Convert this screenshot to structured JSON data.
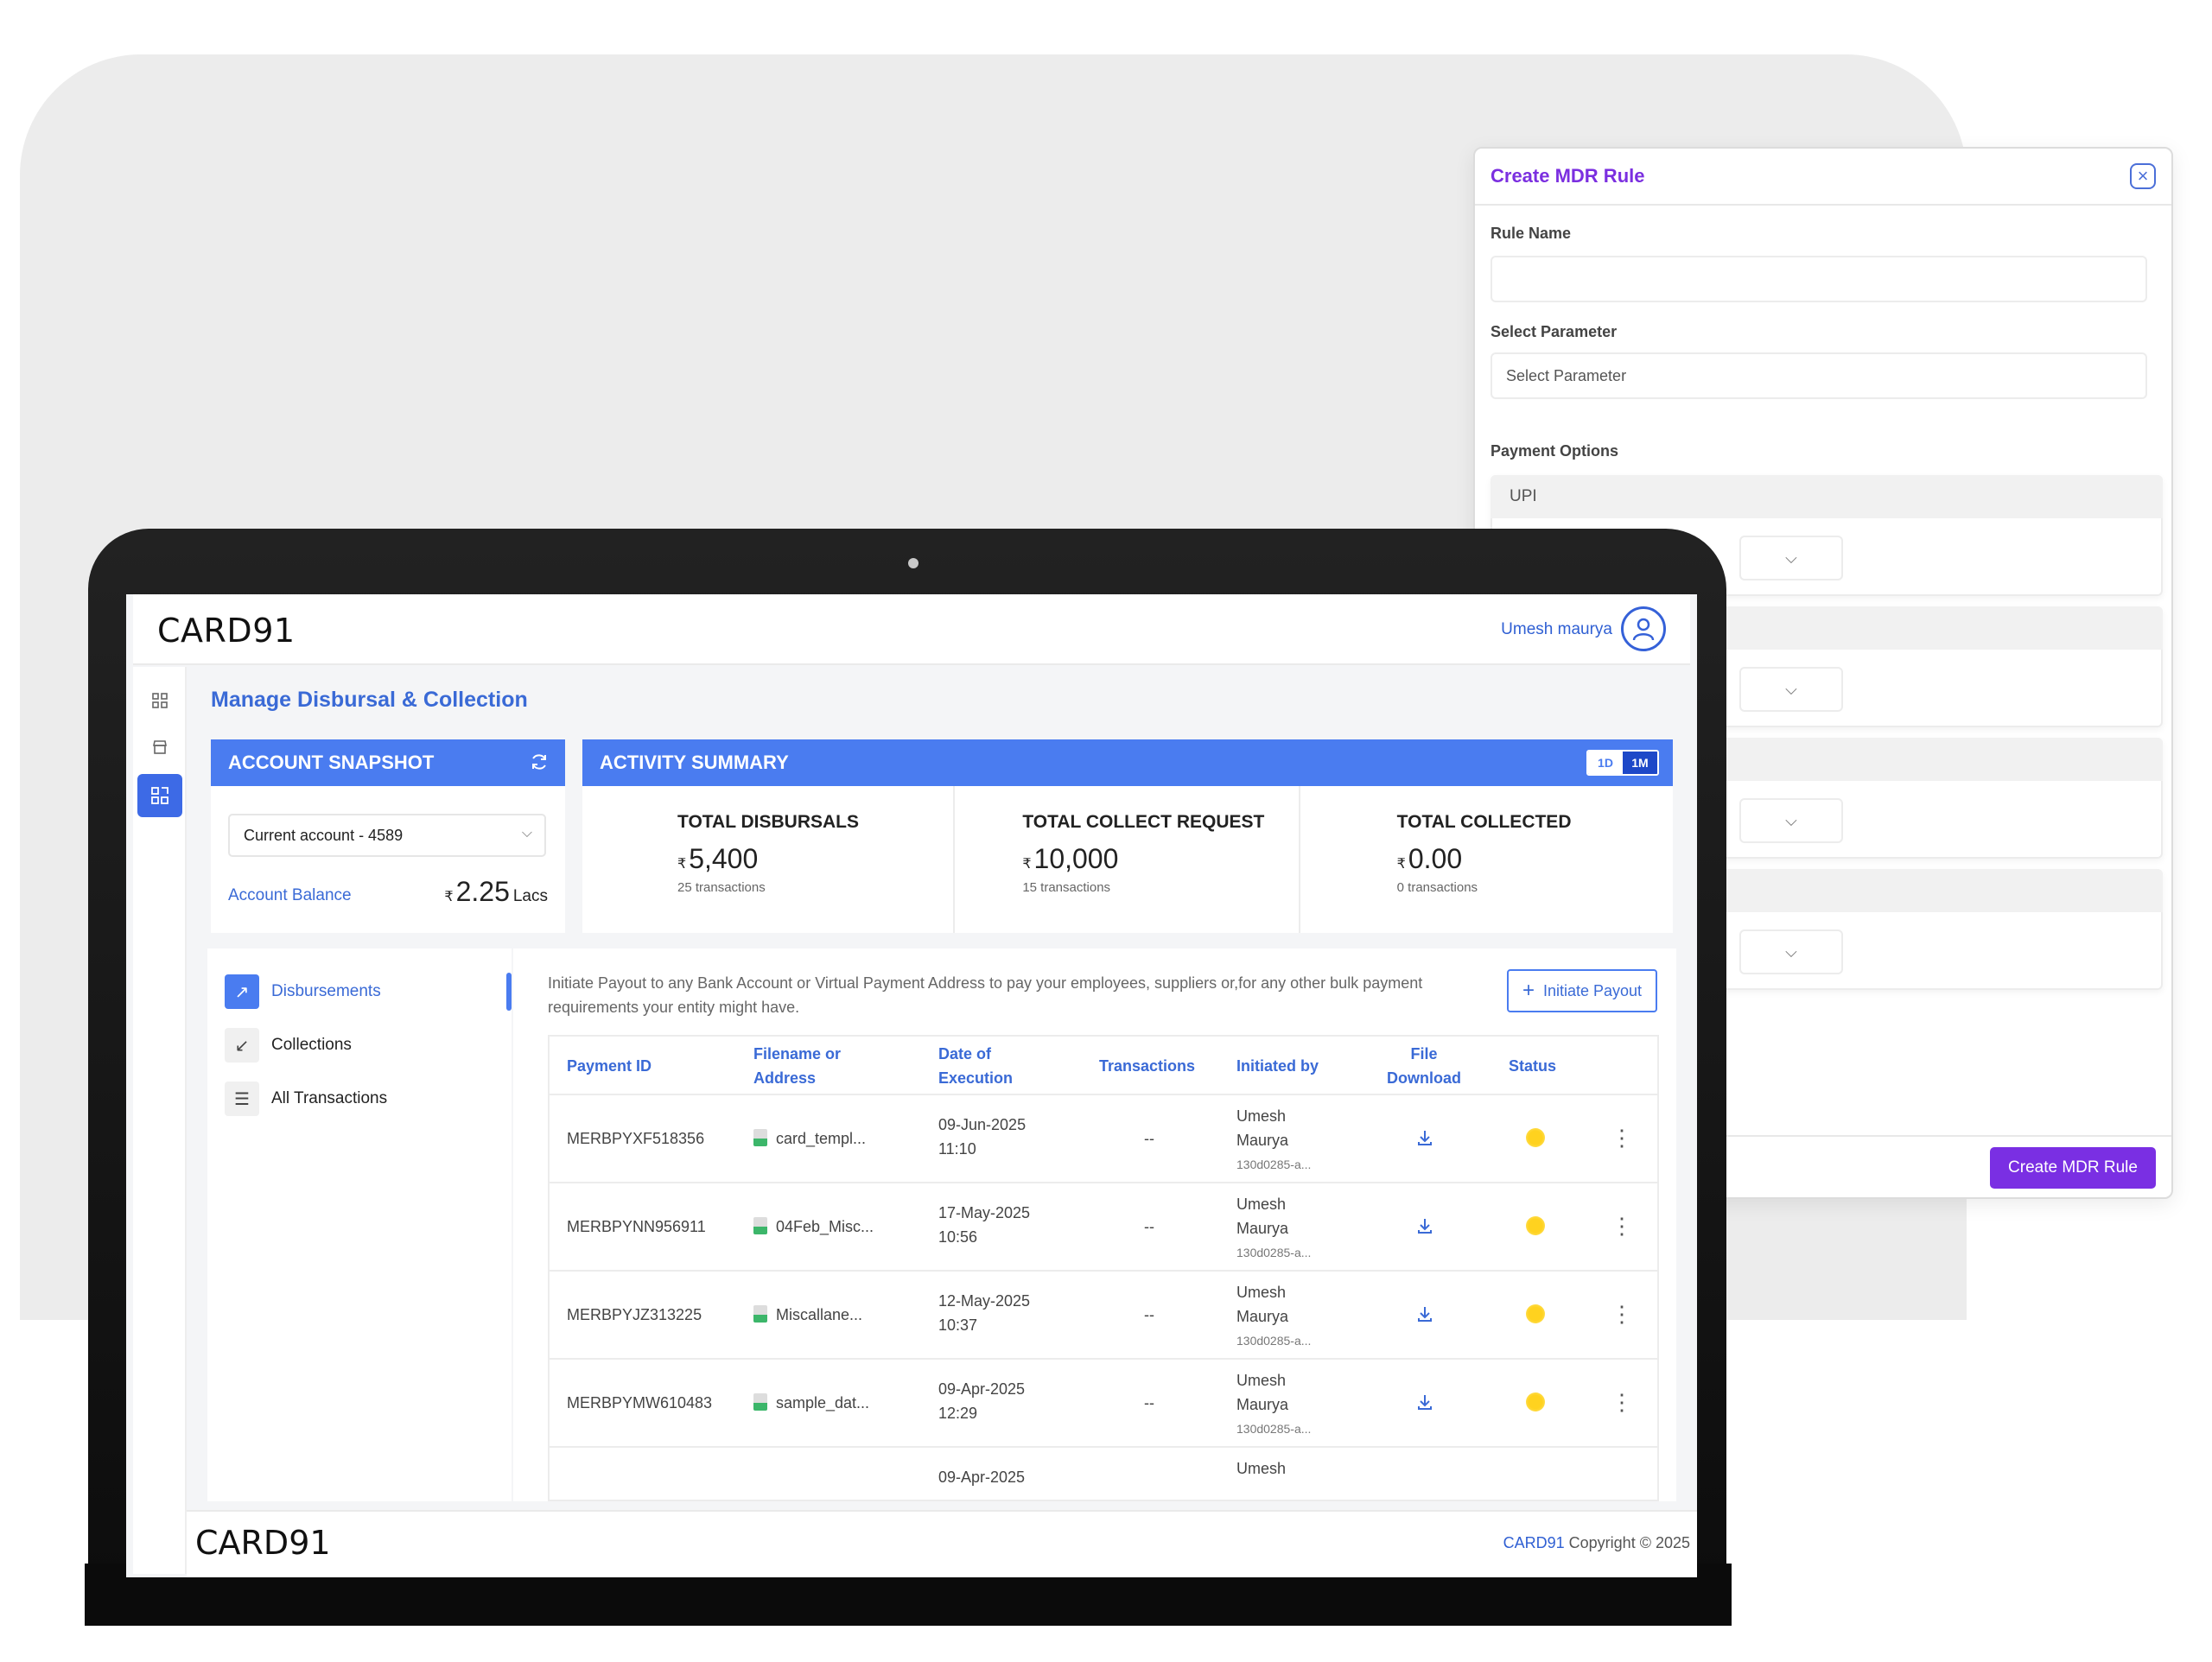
{
  "modal": {
    "title": "Create MDR Rule",
    "rule_name_label": "Rule Name",
    "rule_name_value": "",
    "select_param_label": "Select Parameter",
    "select_param_placeholder": "Select Parameter",
    "payment_options_label": "Payment Options",
    "payment_options": [
      "UPI",
      "",
      "",
      ""
    ],
    "submit_label": "Create MDR Rule"
  },
  "app": {
    "logo": "CARD91",
    "user_name": "Umesh maurya",
    "page_title": "Manage Disbursal & Collection"
  },
  "snapshot": {
    "title": "ACCOUNT SNAPSHOT",
    "account_select": "Current account - 4589",
    "balance_label": "Account Balance",
    "currency": "₹",
    "balance_value": "2.25",
    "balance_unit": "Lacs"
  },
  "activity": {
    "title": "ACTIVITY SUMMARY",
    "range_options": [
      "1D",
      "1M"
    ],
    "range_selected": "1M",
    "cards": [
      {
        "title": "TOTAL DISBURSALS",
        "currency": "₹",
        "value": "5,400",
        "sub": "25 transactions"
      },
      {
        "title": "TOTAL COLLECT REQUEST",
        "currency": "₹",
        "value": "10,000",
        "sub": "15 transactions"
      },
      {
        "title": "TOTAL COLLECTED",
        "currency": "₹",
        "value": "0.00",
        "sub": "0 transactions"
      }
    ]
  },
  "nav": {
    "items": [
      {
        "label": "Disbursements",
        "icon": "arrow-up-right-icon",
        "active": true
      },
      {
        "label": "Collections",
        "icon": "arrow-down-left-icon",
        "active": false
      },
      {
        "label": "All Transactions",
        "icon": "list-icon",
        "active": false
      }
    ]
  },
  "main": {
    "description": "Initiate Payout to any Bank Account or Virtual Payment Address to pay your employees, suppliers or,for any other bulk payment requirements your entity might have.",
    "initiate_label": "Initiate Payout",
    "columns": [
      "Payment ID",
      "Filename or Address",
      "Date of Execution",
      "Transactions",
      "Initiated by",
      "File Download",
      "Status"
    ],
    "rows": [
      {
        "id": "MERBPYXF518356",
        "file": "card_templ...",
        "date": "09-Jun-2025",
        "time": "11:10",
        "txn": "--",
        "by_first": "Umesh",
        "by_last": "Maurya",
        "by_id": "130d0285-a..."
      },
      {
        "id": "MERBPYNN956911",
        "file": "04Feb_Misc...",
        "date": "17-May-2025",
        "time": "10:56",
        "txn": "--",
        "by_first": "Umesh",
        "by_last": "Maurya",
        "by_id": "130d0285-a..."
      },
      {
        "id": "MERBPYJZ313225",
        "file": "Miscallane...",
        "date": "12-May-2025",
        "time": "10:37",
        "txn": "--",
        "by_first": "Umesh",
        "by_last": "Maurya",
        "by_id": "130d0285-a..."
      },
      {
        "id": "MERBPYMW610483",
        "file": "sample_dat...",
        "date": "09-Apr-2025",
        "time": "12:29",
        "txn": "--",
        "by_first": "Umesh",
        "by_last": "Maurya",
        "by_id": "130d0285-a..."
      },
      {
        "id": "",
        "file": "",
        "date": "09-Apr-2025",
        "time": "",
        "txn": "",
        "by_first": "Umesh",
        "by_last": "",
        "by_id": ""
      }
    ]
  },
  "footer": {
    "logo": "CARD91",
    "brand": "CARD91",
    "copyright": "Copyright © 2025"
  },
  "colors": {
    "accent": "#4a7cf0",
    "link": "#3a6ad6",
    "modal_accent": "#7a2fe3",
    "status_pending": "#ffd21f"
  }
}
